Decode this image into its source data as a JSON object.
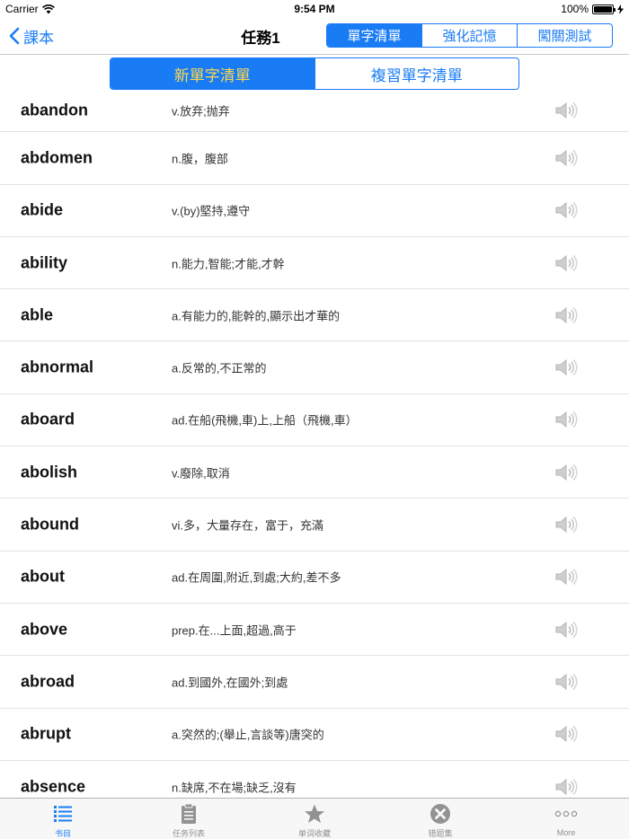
{
  "status_bar": {
    "carrier": "Carrier",
    "time": "9:54 PM",
    "battery": "100%"
  },
  "nav": {
    "back_label": "課本",
    "title": "任務1",
    "segments": [
      "單字清單",
      "強化記憶",
      "闖關測試"
    ],
    "active_segment": 0
  },
  "sub_segments": {
    "items": [
      "新單字清單",
      "複習單字清單"
    ],
    "active": 0
  },
  "words": [
    {
      "word": "abandon",
      "meaning": "v.放弃;抛弃"
    },
    {
      "word": "abdomen",
      "meaning": "n.腹，腹部"
    },
    {
      "word": "abide",
      "meaning": "v.(by)堅持,遵守"
    },
    {
      "word": "ability",
      "meaning": "n.能力,智能;才能,才幹"
    },
    {
      "word": "able",
      "meaning": "a.有能力的,能幹的,顯示出才華的"
    },
    {
      "word": "abnormal",
      "meaning": "a.反常的,不正常的"
    },
    {
      "word": "aboard",
      "meaning": "ad.在船(飛機,車)上,上船（飛機,車）"
    },
    {
      "word": "abolish",
      "meaning": "v.廢除,取消"
    },
    {
      "word": "abound",
      "meaning": "vi.多，大量存在，富于，充滿"
    },
    {
      "word": "about",
      "meaning": "ad.在周圍,附近,到處;大約,差不多"
    },
    {
      "word": "above",
      "meaning": "prep.在...上面,超過,高于"
    },
    {
      "word": "abroad",
      "meaning": "ad.到國外,在國外;到處"
    },
    {
      "word": "abrupt",
      "meaning": "a.突然的;(舉止,言談等)唐突的"
    },
    {
      "word": "absence",
      "meaning": "n.缺席,不在場;缺乏,沒有"
    }
  ],
  "tab_bar": {
    "items": [
      {
        "label": "书目",
        "icon": "list-icon"
      },
      {
        "label": "任务列表",
        "icon": "clipboard-icon"
      },
      {
        "label": "单词收藏",
        "icon": "star-icon"
      },
      {
        "label": "错题集",
        "icon": "x-circle-icon"
      },
      {
        "label": "More",
        "icon": "more-dots-icon"
      }
    ],
    "active": 0
  },
  "colors": {
    "accent": "#1a7cf5",
    "active_sub_text": "#ffd84a",
    "tab_inactive": "#929292"
  }
}
